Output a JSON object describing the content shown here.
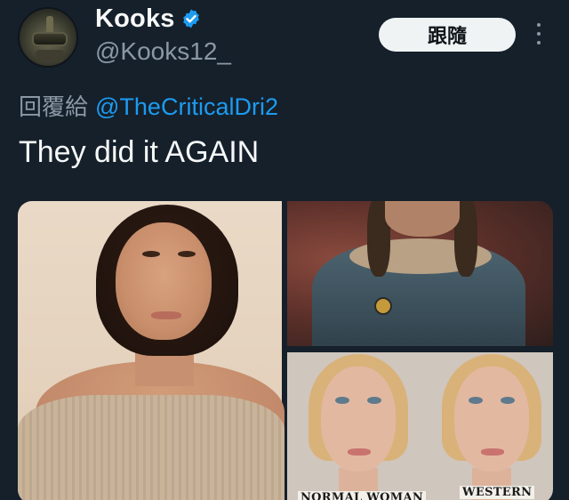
{
  "tweet": {
    "author": {
      "display_name": "Kooks",
      "handle": "@Kooks12_",
      "verified": true
    },
    "follow_label": "跟隨",
    "reply": {
      "prefix": "回覆給",
      "to": "@TheCriticalDri2"
    },
    "text": "They did it AGAIN",
    "media": {
      "captions": {
        "left": "NORMAL WOMAN",
        "right": "WESTERN"
      }
    }
  },
  "colors": {
    "background": "#15202b",
    "link": "#1d9bf0",
    "secondary_text": "#8b98a5",
    "verified": "#1d9bf0"
  },
  "icons": {
    "verified": "verified-badge-icon",
    "more": "more-options-icon"
  }
}
